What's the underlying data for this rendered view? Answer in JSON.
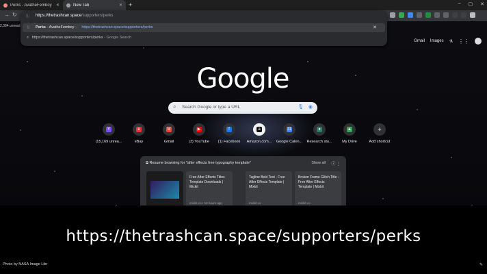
{
  "tabs": [
    {
      "title": "Perks - AvatheFemboy",
      "fav_color": "#f28b82"
    },
    {
      "title": "New Tab",
      "fav_color": "#9aa0a6"
    }
  ],
  "new_tab_symbol": "+",
  "window_controls": [
    "–",
    "▢",
    "✕"
  ],
  "omnibox": {
    "input_host": "https://thetrashcan.space",
    "input_rest": "/supporters/perks",
    "suggestion1_title": "Perks",
    "suggestion1_sep": " - AvatheFemboy - ",
    "suggestion1_url": "https://thetrashcan.space/supporters/perks",
    "suggestion2_url": "https://thetrashcan.space/supporters/perks",
    "suggestion2_suffix": " - Google Search"
  },
  "unread_label": "2,384 unread",
  "toplinks": {
    "gmail": "Gmail",
    "images": "Images"
  },
  "logo_text": "Google",
  "search": {
    "placeholder": "Search Google or type a URL"
  },
  "shortcuts": [
    {
      "label": "(15,169 unrea...",
      "color": "#7c4dff",
      "glyph": "Y"
    },
    {
      "label": "eBay",
      "color": "#e53238",
      "glyph": "e"
    },
    {
      "label": "Gmail",
      "color": "#ea4335",
      "glyph": "M"
    },
    {
      "label": "(3) YouTube",
      "color": "#ff0000",
      "glyph": "▶"
    },
    {
      "label": "(1) Facebook",
      "color": "#1877f2",
      "glyph": "f"
    },
    {
      "label": "Amazon.com...",
      "color": "#111111",
      "glyph": "a"
    },
    {
      "label": "Google Calen...",
      "color": "#4285f4",
      "glyph": "31"
    },
    {
      "label": "Research stu...",
      "color": "#2e7d6b",
      "glyph": "●"
    },
    {
      "label": "My Drive",
      "color": "#34a853",
      "glyph": "▲"
    },
    {
      "label": "Add shortcut",
      "color": "#303134",
      "glyph": "+"
    }
  ],
  "resume": {
    "header": "Resume browsing for \"after effects free typography template\"",
    "show_all": "Show all",
    "cards": [
      {
        "title": "Free After Effects Titles Template Downloads | Mixkit",
        "source": "mixkit.co • 12 hours ago"
      },
      {
        "title": "Tagline Bold Text - Free After Effects Template | Mixkit",
        "source": "mixkit.co"
      },
      {
        "title": "Broken Frame Glitch Title - Free After Effects Template | Mixkit",
        "source": "mixkit.co"
      }
    ]
  },
  "caption": "https://thetrashcan.space/supporters/perks",
  "credit": "Photo by NASA Image Libr"
}
